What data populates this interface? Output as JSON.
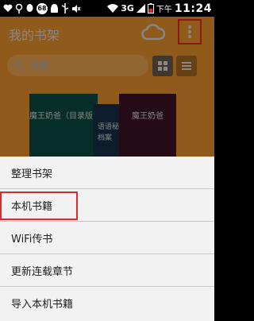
{
  "status_bar": {
    "notif_count": "68",
    "network": "3G",
    "am_pm": "下午",
    "time": "11:24"
  },
  "header": {
    "title": "我的书架",
    "cloud_icon": "cloud-icon",
    "menu_icon": "more-vert-icon",
    "highlight_color": "#e32826"
  },
  "search": {
    "placeholder": "搜索"
  },
  "books": [
    {
      "title": "魔王奶爸（目录版）"
    },
    {
      "title": "语语秘档案"
    },
    {
      "title": "魔王奶爸"
    }
  ],
  "menu": {
    "items": [
      {
        "label": "整理书架"
      },
      {
        "label": "本机书籍"
      },
      {
        "label": "WiFi传书"
      },
      {
        "label": "更新连载章节"
      },
      {
        "label": "导入本机书籍"
      }
    ]
  },
  "colors": {
    "app_bg": "#e8922c",
    "menu_bg": "#f2f2f2"
  }
}
